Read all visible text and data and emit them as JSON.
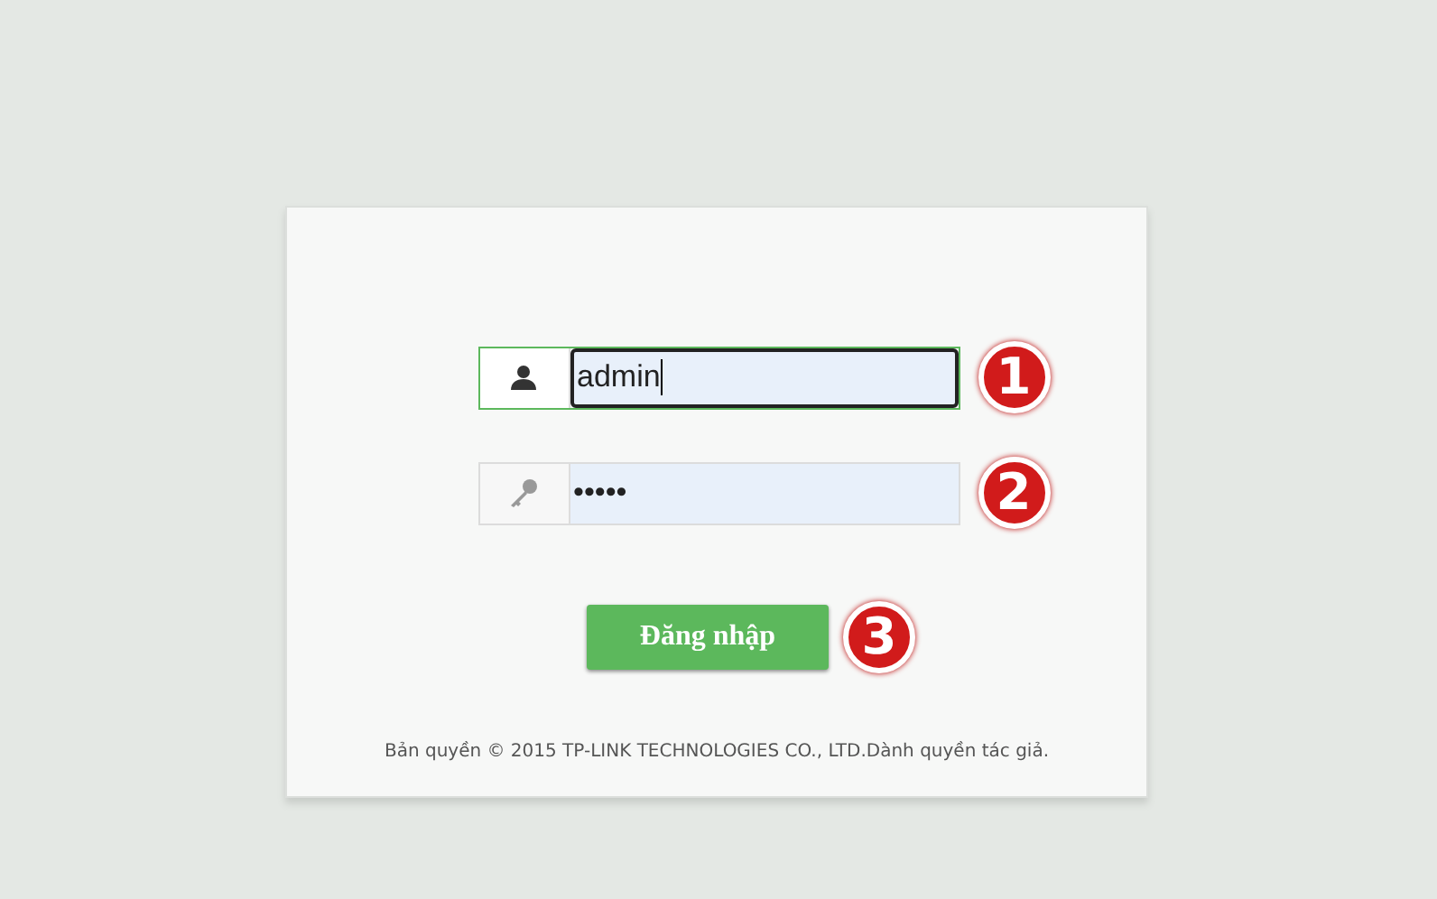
{
  "login_form": {
    "fields": [
      {
        "kind": "username",
        "value": "admin",
        "focused": true,
        "marker": "1"
      },
      {
        "kind": "password",
        "value": "•••••",
        "focused": false,
        "marker": "2"
      }
    ],
    "submit": {
      "label": "Đăng nhập",
      "marker": "3"
    }
  },
  "footer": {
    "copyright": "Bản quyền © 2015 TP-LINK TECHNOLOGIES CO., LTD.Dành quyền tác giả."
  }
}
